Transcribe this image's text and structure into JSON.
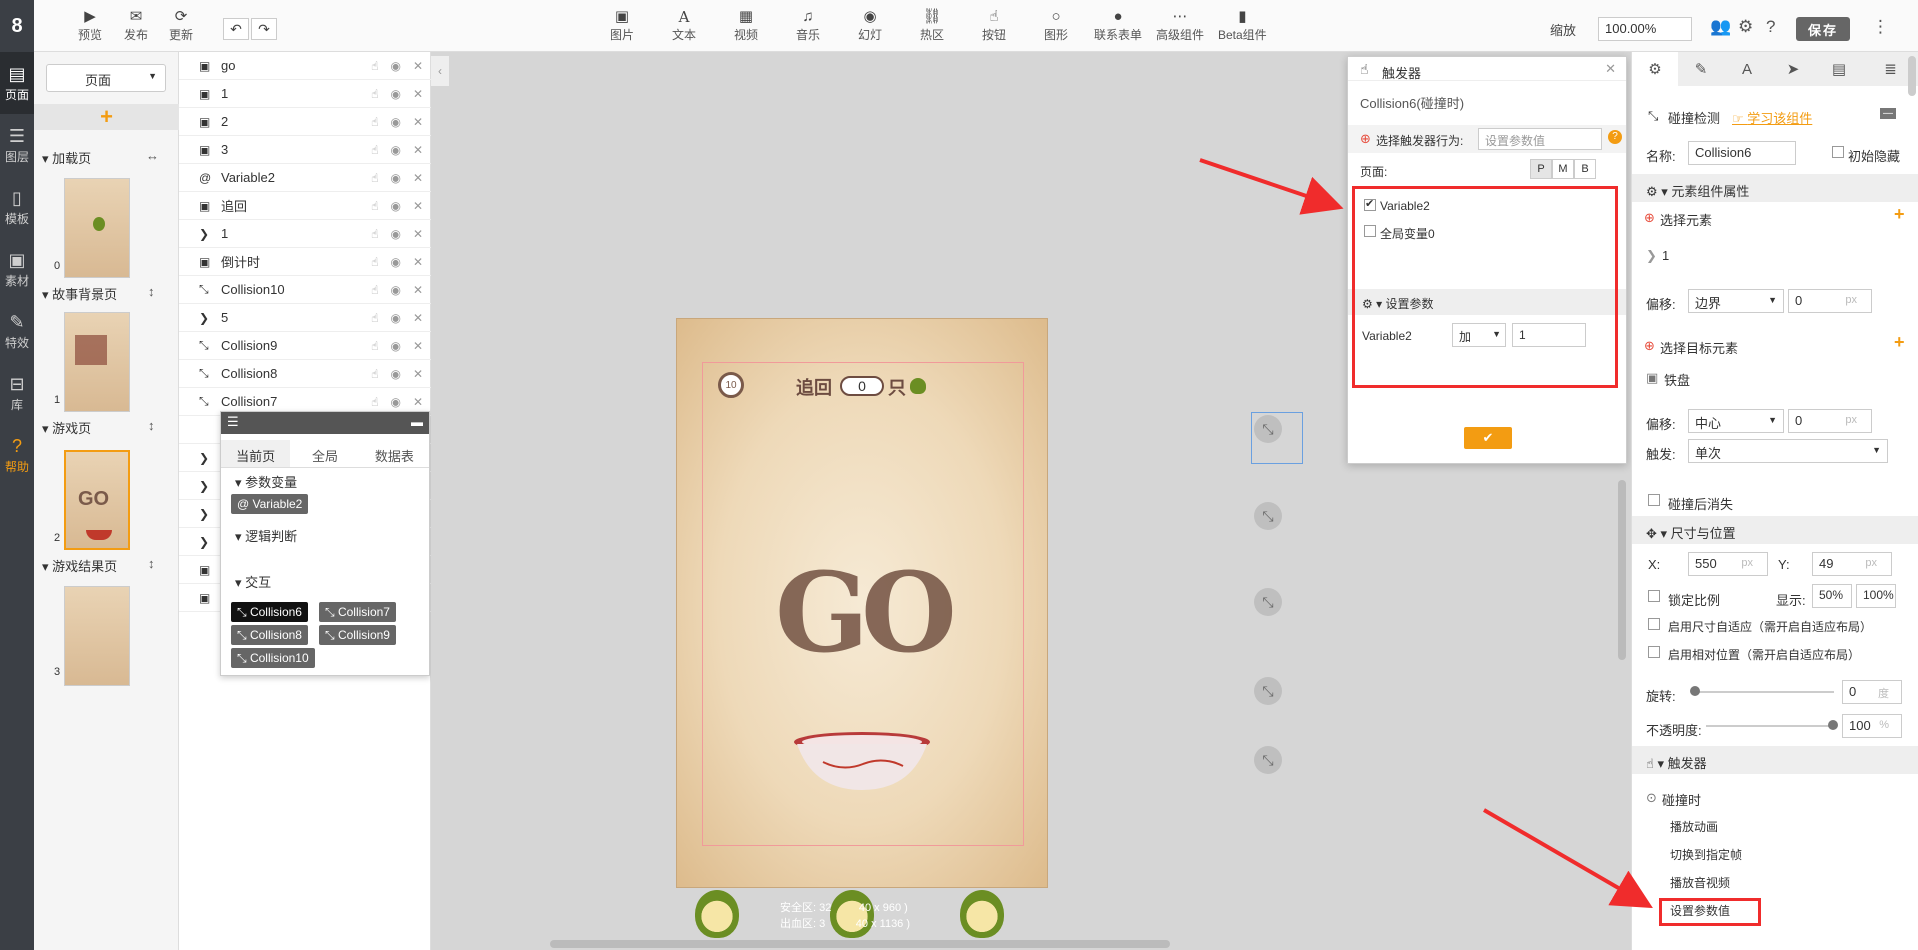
{
  "leftbar": {
    "logo": "8",
    "items": [
      {
        "label": "页面",
        "icon": "page-icon"
      },
      {
        "label": "图层",
        "icon": "layers-icon"
      },
      {
        "label": "模板",
        "icon": "template-icon"
      },
      {
        "label": "素材",
        "icon": "image-icon"
      },
      {
        "label": "特效",
        "icon": "wrench-icon"
      },
      {
        "label": "库",
        "icon": "box-icon"
      },
      {
        "label": "帮助",
        "icon": "question-icon"
      }
    ]
  },
  "toolbar": {
    "left": [
      {
        "label": "预览",
        "icon": "play-icon"
      },
      {
        "label": "发布",
        "icon": "wechat-icon"
      },
      {
        "label": "更新",
        "icon": "refresh-icon"
      }
    ],
    "center": [
      {
        "label": "图片",
        "icon": "image-icon"
      },
      {
        "label": "文本",
        "icon": "text-icon"
      },
      {
        "label": "视频",
        "icon": "film-icon"
      },
      {
        "label": "音乐",
        "icon": "music-icon"
      },
      {
        "label": "幻灯",
        "icon": "slideshow-icon"
      },
      {
        "label": "热区",
        "icon": "link-icon"
      },
      {
        "label": "按钮",
        "icon": "pointer-icon"
      },
      {
        "label": "图形",
        "icon": "circle-icon"
      },
      {
        "label": "联系表单",
        "icon": "user-icon"
      },
      {
        "label": "高级组件",
        "icon": "more-icon"
      },
      {
        "label": "Beta组件",
        "icon": "tablet-icon"
      }
    ],
    "zoom_label": "缩放",
    "zoom_value": "100.00%",
    "save_label": "保存"
  },
  "pages": {
    "selector": "页面",
    "groups": [
      {
        "title": "加载页",
        "num": "0"
      },
      {
        "title": "故事背景页",
        "num": "1"
      },
      {
        "title": "游戏页",
        "num": "2"
      },
      {
        "title": "游戏结果页",
        "num": "3"
      }
    ]
  },
  "layers": [
    {
      "name": "go",
      "icon": "image-icon"
    },
    {
      "name": "1",
      "icon": "image-icon"
    },
    {
      "name": "2",
      "icon": "image-icon"
    },
    {
      "name": "3",
      "icon": "image-icon"
    },
    {
      "name": "Variable2",
      "icon": "at-icon"
    },
    {
      "name": "追回",
      "icon": "image-icon"
    },
    {
      "name": "1",
      "icon": "slideshow-icon"
    },
    {
      "name": "倒计时",
      "icon": "image-icon"
    },
    {
      "name": "Collision10",
      "icon": "collision-icon"
    },
    {
      "name": "5",
      "icon": "slideshow-icon"
    },
    {
      "name": "Collision9",
      "icon": "collision-icon"
    },
    {
      "name": "Collision8",
      "icon": "collision-icon"
    },
    {
      "name": "Collision7",
      "icon": "collision-icon"
    }
  ],
  "varpanel": {
    "tabs": [
      "当前页",
      "全局",
      "数据表"
    ],
    "section_params": "参数变量",
    "variable_tag": "Variable2",
    "section_logic": "逻辑判断",
    "section_interact": "交互",
    "collisions": [
      "Collision6",
      "Collision7",
      "Collision8",
      "Collision9",
      "Collision10"
    ]
  },
  "canvas": {
    "counter_value": "0",
    "timer_value": "10",
    "hud_label_left": "追回",
    "hud_label_right": "只",
    "go_text": "GO",
    "safe_line1": "安全区: 32",
    "safe_line1b": "40 x 960 )",
    "safe_line2": "出血区: 3",
    "safe_line2b": "40 x 1136 )"
  },
  "trigger": {
    "title": "触发器",
    "subtitle": "Collision6(碰撞时)",
    "select_label": "选择触发器行为:",
    "select_placeholder": "设置参数值",
    "page_label": "页面:",
    "page_buttons": [
      "P",
      "M",
      "B"
    ],
    "checks": [
      {
        "label": "Variable2",
        "checked": true
      },
      {
        "label": "全局变量0",
        "checked": false
      }
    ],
    "params_title": "设置参数",
    "param_name": "Variable2",
    "param_op": "加",
    "param_value": "1"
  },
  "props": {
    "title": "碰撞检测",
    "learn_link": "学习该组件",
    "name_label": "名称:",
    "name_value": "Collision6",
    "init_hidden": "初始隐藏",
    "sec_attrs": "元素组件属性",
    "select_elem": "选择元素",
    "elem_item": "1",
    "offset_label": "偏移:",
    "offset1_sel": "边界",
    "offset1_val": "0",
    "px": "px",
    "select_target": "选择目标元素",
    "target_item": "铁盘",
    "offset2_sel": "中心",
    "offset2_val": "0",
    "trigger_label": "触发:",
    "trigger_sel": "单次",
    "vanish": "碰撞后消失",
    "sec_size": "尺寸与位置",
    "x_label": "X:",
    "x_val": "550",
    "y_label": "Y:",
    "y_val": "49",
    "lock_ratio": "锁定比例",
    "display_label": "显示:",
    "display_a": "50%",
    "display_b": "100%",
    "auto_size": "启用尺寸自适应（需开启自适应布局）",
    "relative_pos": "启用相对位置（需开启自适应布局）",
    "rotate_label": "旋转:",
    "rotate_val": "0",
    "rotate_unit": "度",
    "opacity_label": "不透明度:",
    "opacity_val": "100",
    "opacity_unit": "%",
    "sec_trigger": "触发器",
    "trig_event": "碰撞时",
    "actions": [
      "播放动画",
      "切换到指定帧",
      "播放音视频",
      "设置参数值"
    ]
  },
  "colors": {
    "accent": "#f39c12",
    "highlight": "#f02c2c",
    "dark": "#3b3f45"
  }
}
